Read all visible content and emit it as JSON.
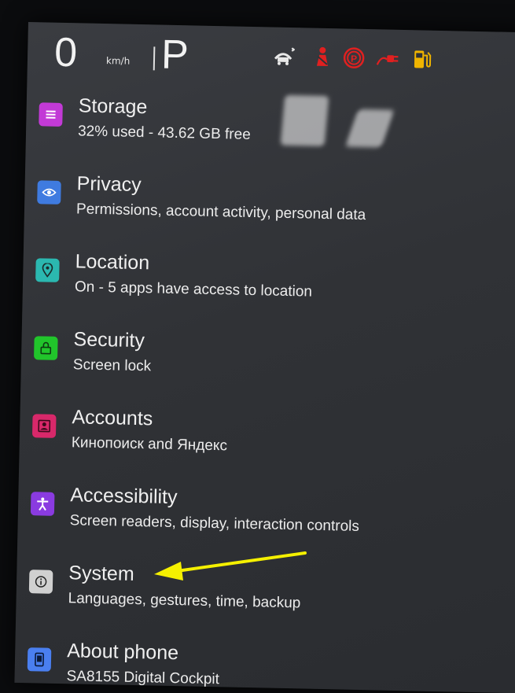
{
  "status": {
    "speed": "0",
    "speed_unit": "km/h",
    "gear": "P",
    "telltales": [
      "parking-sensor-icon",
      "seatbelt-warning-icon",
      "parking-brake-icon",
      "charging-plug-icon",
      "fuel-icon"
    ],
    "colors": {
      "warning": "#e02020",
      "fuel": "#f0b400"
    }
  },
  "settings": {
    "items": [
      {
        "title": "Storage",
        "subtitle": "32% used - 43.62 GB free",
        "icon": "storage-icon",
        "color": "#c23ad6"
      },
      {
        "title": "Privacy",
        "subtitle": "Permissions, account activity, personal data",
        "icon": "privacy-eye-icon",
        "color": "#3f7be0"
      },
      {
        "title": "Location",
        "subtitle": "On - 5 apps have access to location",
        "icon": "location-pin-icon",
        "color": "#2bb8b0"
      },
      {
        "title": "Security",
        "subtitle": "Screen lock",
        "icon": "lock-icon",
        "color": "#21c52b"
      },
      {
        "title": "Accounts",
        "subtitle": "Кинопоиск and Яндекс",
        "icon": "account-box-icon",
        "color": "#d8286a"
      },
      {
        "title": "Accessibility",
        "subtitle": "Screen readers, display, interaction controls",
        "icon": "accessibility-icon",
        "color": "#8a3be0"
      },
      {
        "title": "System",
        "subtitle": "Languages, gestures, time, backup",
        "icon": "info-icon",
        "color": "#d0d0d0"
      },
      {
        "title": "About phone",
        "subtitle": "SA8155 Digital Cockpit",
        "icon": "phone-icon",
        "color": "#4a7ff0"
      }
    ]
  },
  "annotation": {
    "arrow_color": "#f5f000"
  }
}
